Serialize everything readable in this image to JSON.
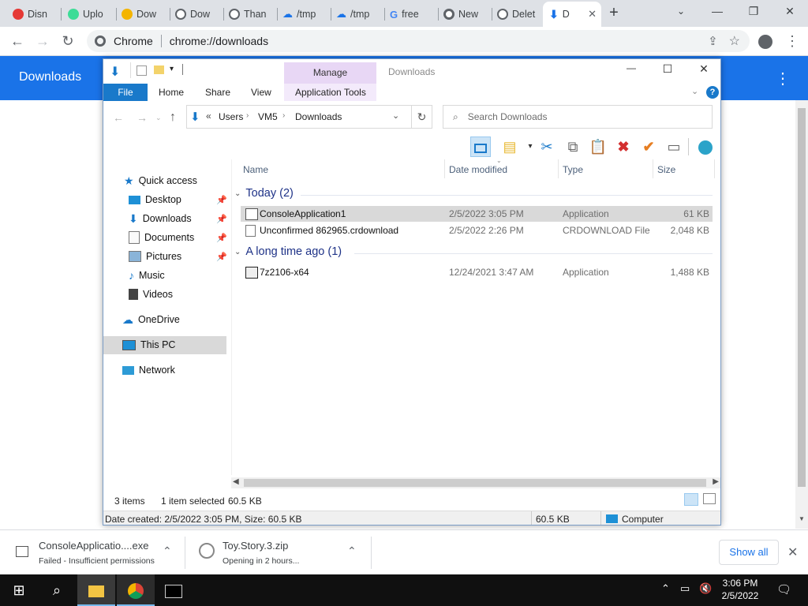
{
  "tabs": [
    {
      "label": "Disn",
      "color": "#e53935"
    },
    {
      "label": "Uplo",
      "color": "#3ddc97"
    },
    {
      "label": "Dow",
      "color": "#f4b400"
    },
    {
      "label": "Dow",
      "color": "#5f6368"
    },
    {
      "label": "Than",
      "color": "#5f6368"
    },
    {
      "label": "/tmp",
      "color": "#1a73e8"
    },
    {
      "label": "/tmp",
      "color": "#1a73e8"
    },
    {
      "label": "free",
      "color": "#4285f4"
    },
    {
      "label": "New",
      "color": "#5f6368"
    },
    {
      "label": "Delet",
      "color": "#5f6368"
    }
  ],
  "active_tab": {
    "label": "D"
  },
  "omnibox": {
    "chip": "Chrome",
    "url": "chrome://downloads"
  },
  "downloads_page": {
    "title": "Downloads"
  },
  "explorer": {
    "manage_tab": "Manage",
    "window_title": "Downloads",
    "ribbon_tabs": [
      "File",
      "Home",
      "Share",
      "View",
      "Application Tools"
    ],
    "breadcrumb": [
      "Users",
      "VM5",
      "Downloads"
    ],
    "search_placeholder": "Search Downloads",
    "columns": {
      "name": "Name",
      "date": "Date modified",
      "type": "Type",
      "size": "Size"
    },
    "nav": {
      "quick_access": "Quick access",
      "desktop": "Desktop",
      "downloads": "Downloads",
      "documents": "Documents",
      "pictures": "Pictures",
      "music": "Music",
      "videos": "Videos",
      "onedrive": "OneDrive",
      "this_pc": "This PC",
      "network": "Network"
    },
    "groups": [
      {
        "title": "Today (2)",
        "files": [
          {
            "name": "ConsoleApplication1",
            "date": "2/5/2022 3:05 PM",
            "type": "Application",
            "size": "61 KB"
          },
          {
            "name": "Unconfirmed 862965.crdownload",
            "date": "2/5/2022 2:26 PM",
            "type": "CRDOWNLOAD File",
            "size": "2,048 KB"
          }
        ]
      },
      {
        "title": "A long time ago (1)",
        "files": [
          {
            "name": "7z2106-x64",
            "date": "12/24/2021 3:47 AM",
            "type": "Application",
            "size": "1,488 KB"
          }
        ]
      }
    ],
    "status": {
      "items": "3 items",
      "selected": "1 item selected",
      "selected_size": "60.5 KB"
    },
    "details": {
      "text": "Date created: 2/5/2022 3:05 PM, Size: 60.5 KB",
      "size": "60.5 KB",
      "location": "Computer"
    }
  },
  "shelf": {
    "items": [
      {
        "name": "ConsoleApplicatio....exe",
        "status": "Failed - Insufficient permissions"
      },
      {
        "name": "Toy.Story.3.zip",
        "status": "Opening in 2 hours..."
      }
    ],
    "show_all": "Show all"
  },
  "taskbar": {
    "time": "3:06 PM",
    "date": "2/5/2022"
  }
}
